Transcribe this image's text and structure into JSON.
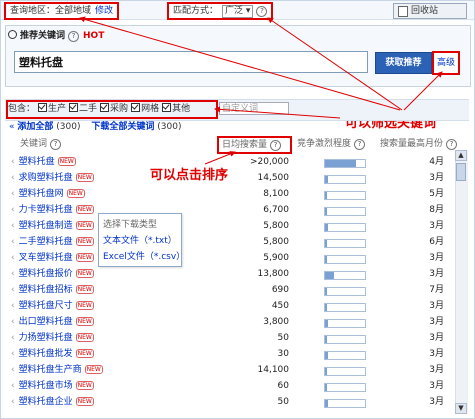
{
  "topbar": {
    "region_label": "查询地区：全部地域",
    "region_link": "修改",
    "match_label": "匹配方式：",
    "match_value": "广泛",
    "recycle_label": "回收站",
    "help_symbol": "?"
  },
  "search": {
    "tab_label": "推荐关键词",
    "hot_label": "HOT",
    "keyword_value": "塑料托盘",
    "submit_label": "获取推荐",
    "advanced_label": "高级"
  },
  "annotations": {
    "filter_note": "可以筛选关键词",
    "sort_note": "可以点击排序"
  },
  "filter": {
    "include_label": "包含：",
    "options": [
      "生产",
      "二手",
      "采购",
      "网格",
      "其他"
    ],
    "custom_placeholder": "自定义词"
  },
  "actions": {
    "add_all": "添加全部",
    "add_count": "(300)",
    "download_all": "下载全部关键词",
    "download_count": "(300)"
  },
  "table": {
    "col_keyword": "关键词",
    "col_volume": "日均搜索量",
    "col_competition": "竞争激烈程度",
    "col_peak_month": "搜索量最高月份",
    "new_tag": "NEW",
    "rows": [
      {
        "keyword": "塑料托盘",
        "is_new": true,
        "volume": ">20,000",
        "competition": 0.78,
        "month": "4月"
      },
      {
        "keyword": "求购塑料托盘",
        "is_new": true,
        "volume": "14,500",
        "competition": 0.08,
        "month": "3月"
      },
      {
        "keyword": "塑料托盘网",
        "is_new": true,
        "volume": "8,100",
        "competition": 0.06,
        "month": "5月"
      },
      {
        "keyword": "力卡塑料托盘",
        "is_new": true,
        "volume": "6,700",
        "competition": 0.06,
        "month": "8月"
      },
      {
        "keyword": "塑料托盘制造",
        "is_new": true,
        "volume": "5,800",
        "competition": 0.08,
        "month": "3月"
      },
      {
        "keyword": "二手塑料托盘",
        "is_new": true,
        "volume": "5,800",
        "competition": 0.06,
        "month": "6月"
      },
      {
        "keyword": "叉车塑料托盘",
        "is_new": true,
        "volume": "5,900",
        "competition": 0.06,
        "month": "3月"
      },
      {
        "keyword": "塑料托盘报价",
        "is_new": true,
        "volume": "13,800",
        "competition": 0.22,
        "month": "3月"
      },
      {
        "keyword": "塑料托盘招标",
        "is_new": true,
        "volume": "690",
        "competition": 0.06,
        "month": "7月"
      },
      {
        "keyword": "塑料托盘尺寸",
        "is_new": true,
        "volume": "450",
        "competition": 0.06,
        "month": "3月"
      },
      {
        "keyword": "出口塑料托盘",
        "is_new": true,
        "volume": "3,800",
        "competition": 0.08,
        "month": "3月"
      },
      {
        "keyword": "力扬塑料托盘",
        "is_new": true,
        "volume": "50",
        "competition": 0.06,
        "month": "3月"
      },
      {
        "keyword": "塑料托盘批发",
        "is_new": true,
        "volume": "30",
        "competition": 0.08,
        "month": "3月"
      },
      {
        "keyword": "塑料托盘生产商",
        "is_new": true,
        "volume": "14,100",
        "competition": 0.06,
        "month": "3月"
      },
      {
        "keyword": "塑料托盘市场",
        "is_new": true,
        "volume": "60",
        "competition": 0.06,
        "month": "3月"
      },
      {
        "keyword": "塑料托盘企业",
        "is_new": true,
        "volume": "50",
        "competition": 0.08,
        "month": "3月"
      }
    ]
  },
  "download_popup": {
    "title": "选择下载类型",
    "option_txt": "文本文件（*.txt）",
    "option_csv": "Excel文件（*.csv）"
  },
  "colors": {
    "annotation_red": "#e00000",
    "link_blue": "#0033cc",
    "button_blue": "#2c62b5",
    "bar_fill": "#7aa0d4"
  }
}
